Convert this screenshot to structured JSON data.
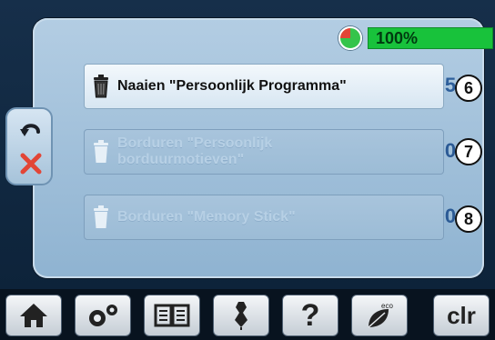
{
  "status": {
    "battery_percent_label": "100%",
    "pie_colors": [
      "#35c44b",
      "#e24536"
    ]
  },
  "list": {
    "items": [
      {
        "label": "Naaien \"Persoonlijk Programma\"",
        "count": "5",
        "state": "active",
        "badge": "6"
      },
      {
        "label_line1": "Borduren \"Persoonlijk",
        "label_line2": "borduurmotieven\"",
        "count": "0",
        "state": "disabled",
        "badge": "7"
      },
      {
        "label": "Borduren \"Memory Stick\"",
        "count": "0",
        "state": "disabled",
        "badge": "8"
      }
    ]
  },
  "side_tab": {
    "icons": [
      "undo-arrow-icon",
      "close-x-icon"
    ]
  },
  "toolbar": {
    "buttons": [
      {
        "icon": "home-icon"
      },
      {
        "icon": "settings-gears-icon"
      },
      {
        "icon": "book-icon"
      },
      {
        "icon": "dress-form-icon"
      },
      {
        "icon": "help-icon",
        "label": "?"
      },
      {
        "icon": "eco-icon",
        "label": "eco"
      },
      {
        "icon": "clear-icon",
        "label": "clr"
      }
    ]
  },
  "colors": {
    "accent_green": "#18c23b",
    "red": "#e24536",
    "count_blue": "#2e5f9b",
    "panel_blue": "#a6c3da"
  }
}
